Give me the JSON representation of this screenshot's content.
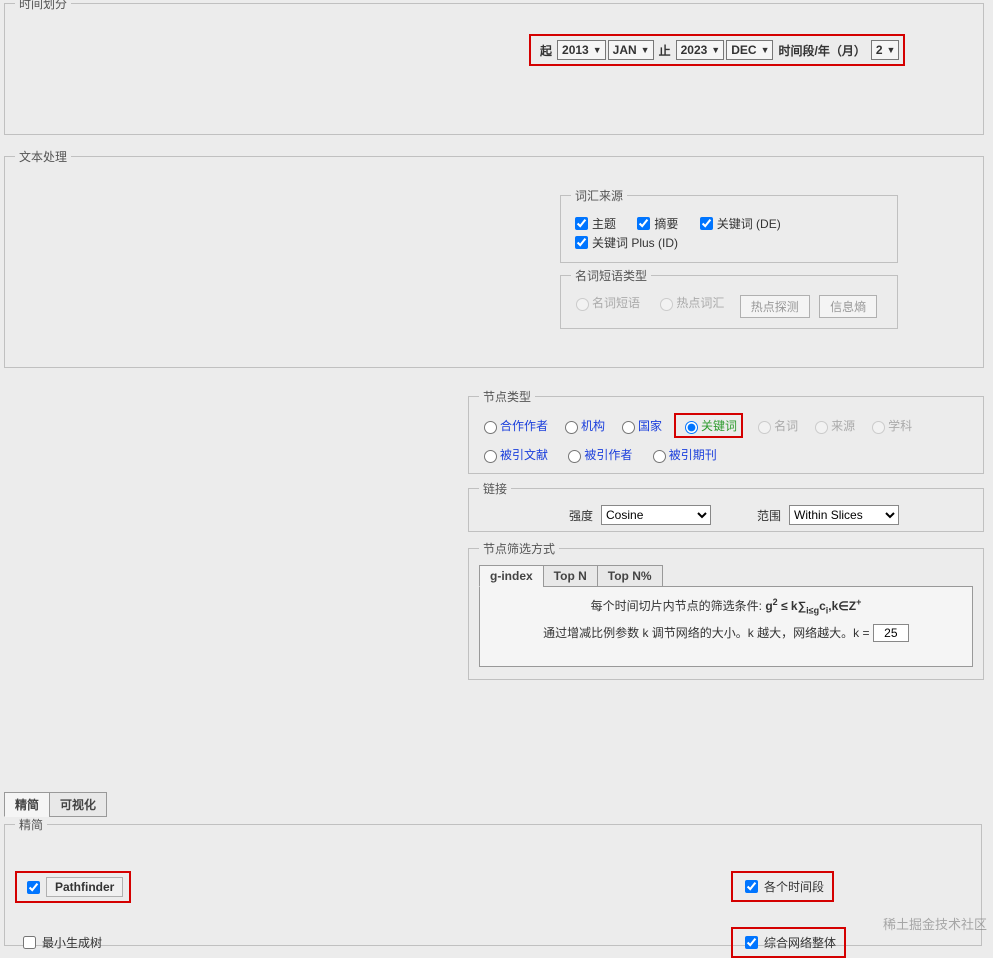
{
  "time_section": {
    "legend": "时间划分",
    "start_label": "起",
    "start_year": "2013",
    "start_month": "JAN",
    "end_label": "止",
    "end_year": "2023",
    "end_month": "DEC",
    "span_label": "时间段/年（月）",
    "span_value": "2"
  },
  "text_section": {
    "legend": "文本处理",
    "source": {
      "legend": "词汇来源",
      "items": [
        "主题",
        "摘要",
        "关键词 (DE)",
        "关键词 Plus (ID)"
      ]
    },
    "noun": {
      "legend": "名词短语类型",
      "radio1": "名词短语",
      "radio2": "热点词汇",
      "btn1": "热点探测",
      "btn2": "信息熵"
    }
  },
  "node_section": {
    "legend": "节点类型",
    "row1": [
      "合作作者",
      "机构",
      "国家",
      "关键词",
      "名词",
      "来源",
      "学科"
    ],
    "row2": [
      "被引文献",
      "被引作者",
      "被引期刊"
    ]
  },
  "link_section": {
    "legend": "链接",
    "strength_label": "强度",
    "strength_value": "Cosine",
    "scope_label": "范围",
    "scope_value": "Within Slices"
  },
  "filter_section": {
    "legend": "节点筛选方式",
    "tabs": [
      "g-index",
      "Top N",
      "Top N%"
    ],
    "line1_prefix": "每个时间切片内节点的筛选条件: ",
    "line2_prefix": "通过增减比例参数 k 调节网络的大小。k 越大，网络越大。k =",
    "k_value": "25"
  },
  "simplify_section": {
    "tabs": [
      "精简",
      "可视化"
    ],
    "legend": "精简",
    "pathfinder": "Pathfinder",
    "each_slice": "各个时间段",
    "mst": "最小生成树",
    "merged": "综合网络整体"
  },
  "watermark": "稀土掘金技术社区"
}
